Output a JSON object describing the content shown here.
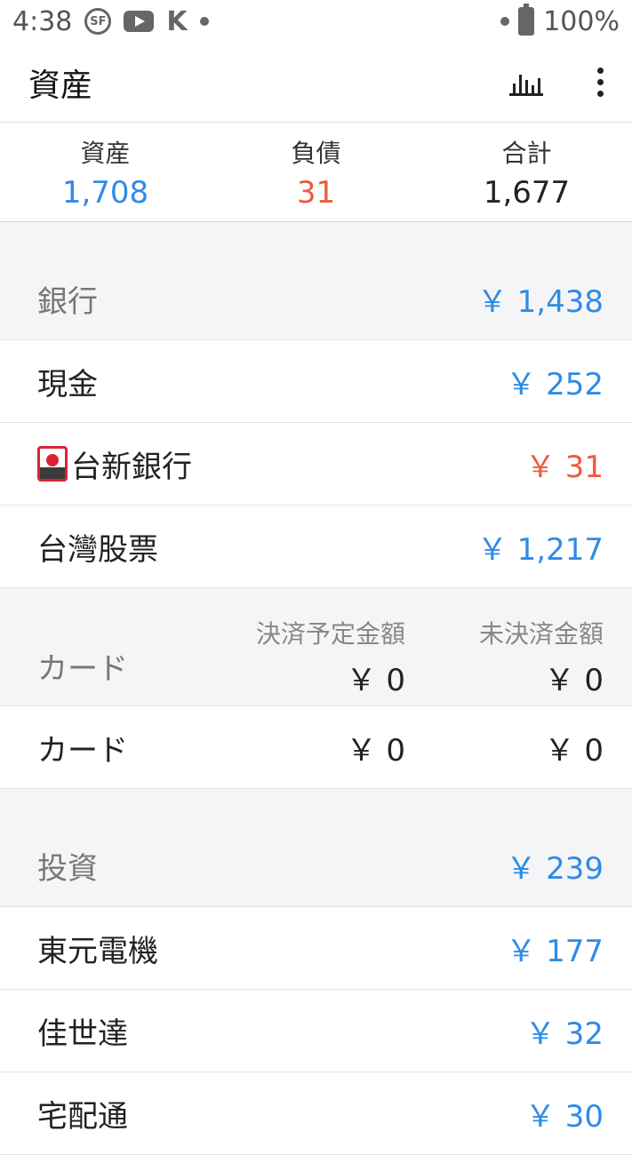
{
  "statusbar": {
    "time": "4:38",
    "battery": "100%",
    "k_label": "K",
    "sf_label": "SF"
  },
  "appbar": {
    "title": "資産"
  },
  "summary": {
    "assets_label": "資産",
    "assets_value": "1,708",
    "liabilities_label": "負債",
    "liabilities_value": "31",
    "total_label": "合計",
    "total_value": "1,677"
  },
  "colors": {
    "positive": "#2f8be6",
    "negative": "#ef5a3c"
  },
  "bank": {
    "header": {
      "name": "銀行",
      "amount": "￥ 1,438"
    },
    "items": [
      {
        "name": "現金",
        "amount": "￥ 252"
      },
      {
        "name": "台新銀行",
        "amount": "￥ 31",
        "icon": "flag-icon"
      },
      {
        "name": "台灣股票",
        "amount": "￥ 1,217"
      }
    ]
  },
  "card": {
    "header": {
      "name": "カード",
      "scheduled_label": "決済予定金額",
      "scheduled_value": "￥ 0",
      "unsettled_label": "未決済金額",
      "unsettled_value": "￥ 0"
    },
    "items": [
      {
        "name": "カード",
        "scheduled": "￥ 0",
        "unsettled": "￥ 0"
      }
    ]
  },
  "investment": {
    "header": {
      "name": "投資",
      "amount": "￥ 239"
    },
    "items": [
      {
        "name": "東元電機",
        "amount": "￥ 177"
      },
      {
        "name": "佳世達",
        "amount": "￥ 32"
      },
      {
        "name": "宅配通",
        "amount": "￥ 30"
      }
    ]
  }
}
